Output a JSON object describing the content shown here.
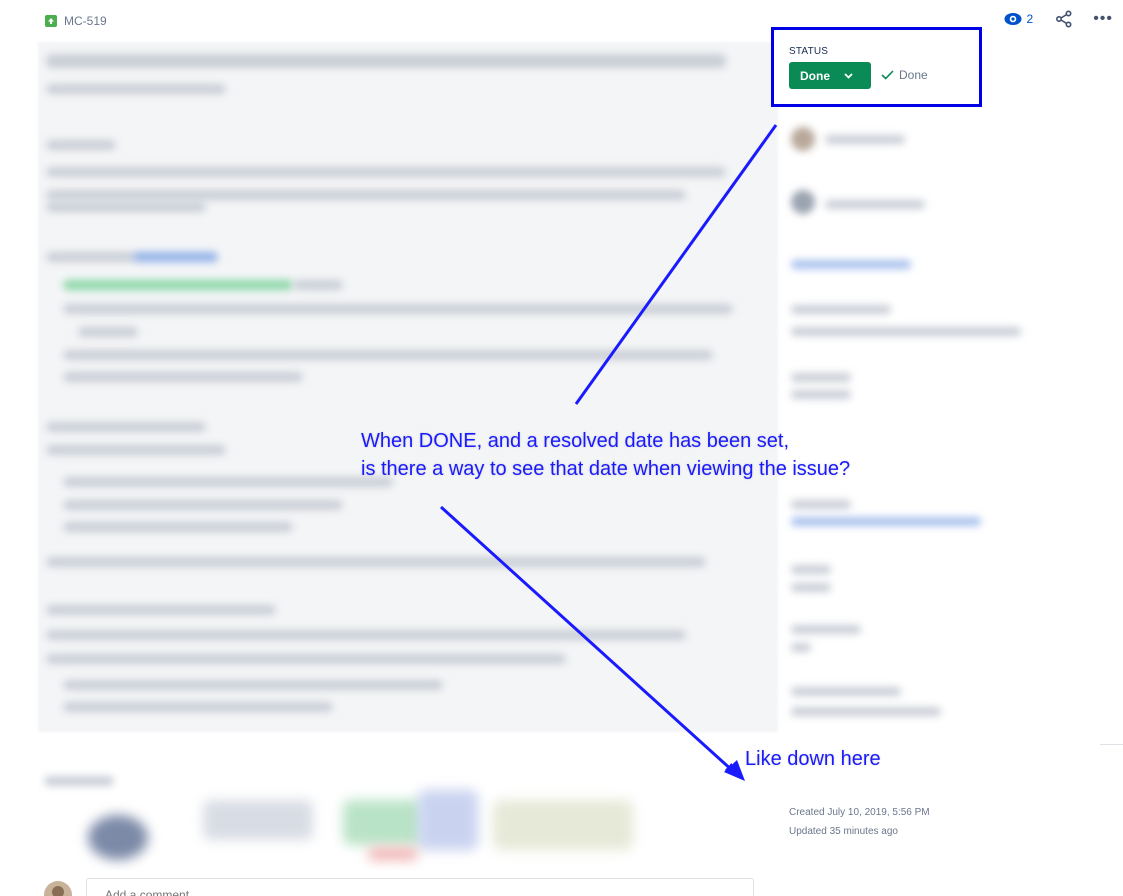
{
  "header": {
    "issue_key": "MC-519",
    "issue_type_icon": "story-arrow-up-icon",
    "watch_count": "2"
  },
  "status_panel": {
    "label": "STATUS",
    "current_status": "Done",
    "resolution": "Done",
    "status_color": "#0a8a55"
  },
  "annotations": {
    "main_line_1": "When DONE, and a resolved date has been set,",
    "main_line_2": "is there a way to see that date when viewing the issue?",
    "pointer": "Like down here",
    "color": "#1a1aff"
  },
  "meta": {
    "created": "Created July 10, 2019, 5:56 PM",
    "updated": "Updated 35 minutes ago"
  },
  "comment": {
    "placeholder": "Add a comment..."
  }
}
